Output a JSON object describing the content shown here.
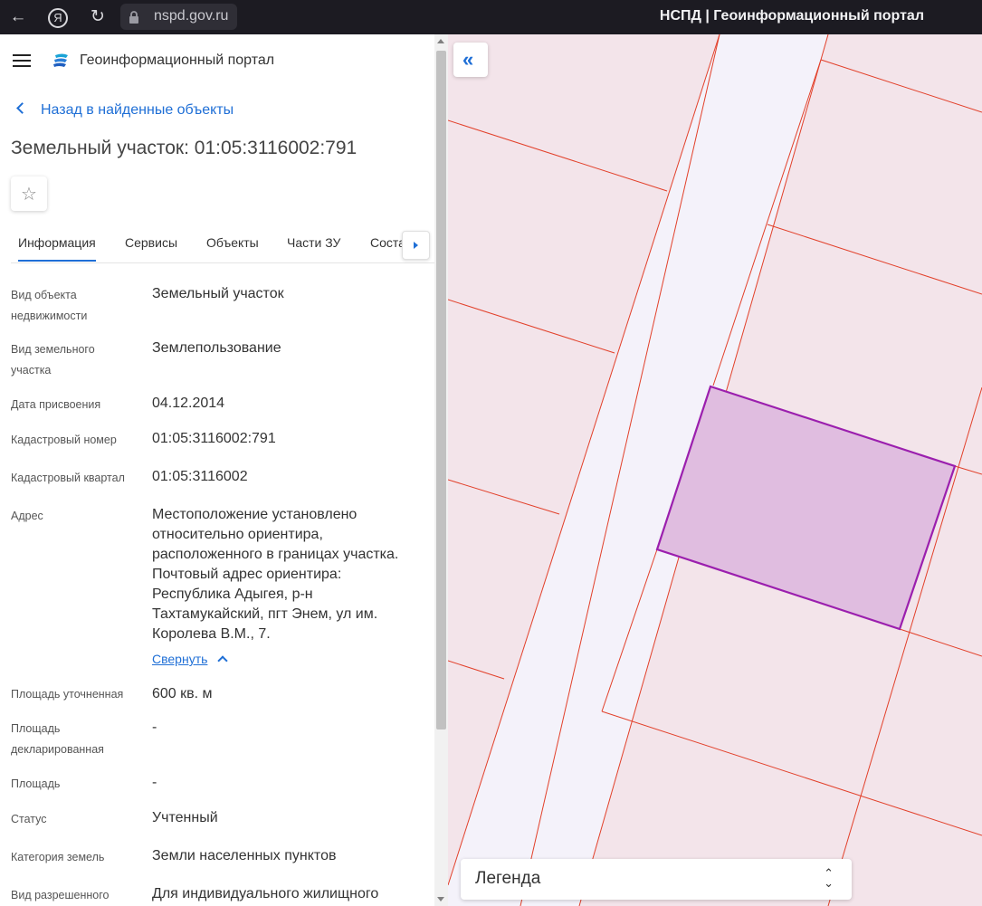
{
  "browser": {
    "url": "nspd.gov.ru",
    "title": "НСПД | Геоинформационный портал"
  },
  "header": {
    "app_title": "Геоинформационный портал"
  },
  "back_link": "Назад в найденные объекты",
  "object_title": "Земельный участок: 01:05:3116002:791",
  "tabs": [
    "Информация",
    "Сервисы",
    "Объекты",
    "Части ЗУ",
    "Состав"
  ],
  "fields": [
    {
      "label": "Вид объекта недвижимости",
      "value": "Земельный участок"
    },
    {
      "label": "Вид земельного участка",
      "value": "Землепользование"
    },
    {
      "label": "Дата присвоения",
      "value": "04.12.2014"
    },
    {
      "label": "Кадастровый номер",
      "value": "01:05:3116002:791"
    },
    {
      "label": "Кадастровый квартал",
      "value": "01:05:3116002"
    },
    {
      "label": "Адрес",
      "value": "Местоположение установлено относительно ориентира, расположенного в границах участка. Почтовый адрес ориентира: Республика Адыгея, р-н Тахтамукайский, пгт Энем, ул им. Королева В.М., 7."
    },
    {
      "label": "Площадь уточненная",
      "value": "600 кв. м"
    },
    {
      "label": "Площадь декларированная",
      "value": "-"
    },
    {
      "label": "Площадь",
      "value": "-"
    },
    {
      "label": "Статус",
      "value": "Учтенный"
    },
    {
      "label": "Категория земель",
      "value": "Земли населенных пунктов"
    },
    {
      "label": "Вид разрешенного",
      "value": "Для индивидуального жилищного"
    }
  ],
  "collapse_link": "Свернуть",
  "legend": {
    "label": "Легенда"
  },
  "colors": {
    "accent": "#1f6fd6",
    "parcel_border": "#9b1fae",
    "parcel_fill": "#e0bde0",
    "map_lines": "#e2402a"
  }
}
